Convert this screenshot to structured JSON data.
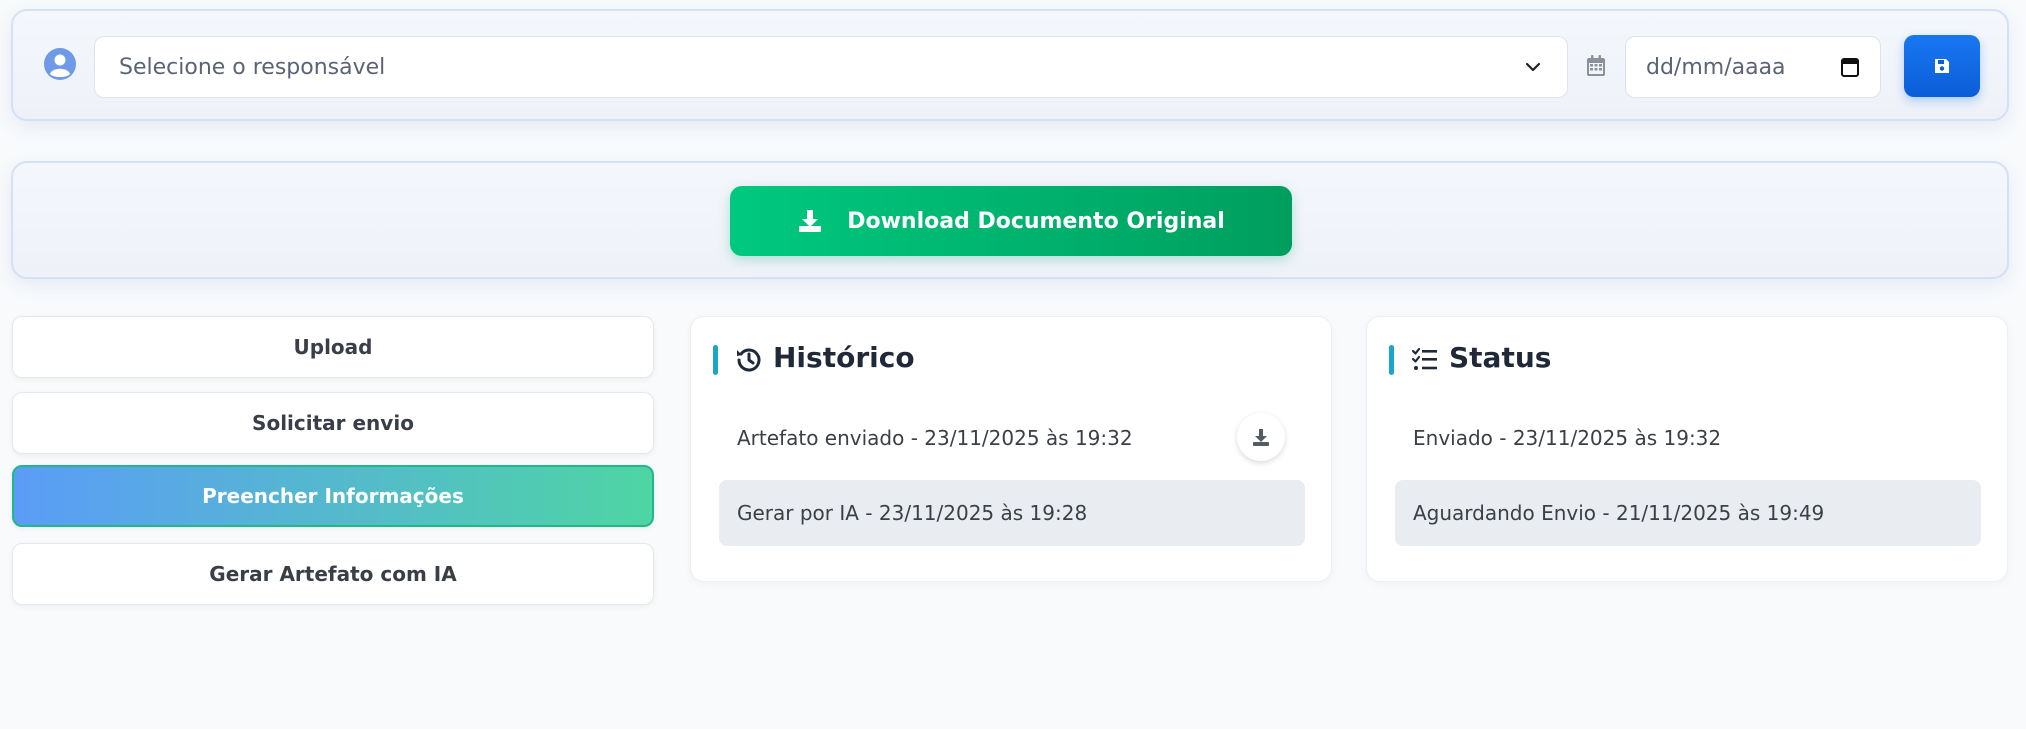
{
  "header": {
    "responsible_placeholder": "Selecione o responsável",
    "date_placeholder": "dd/mm/aaaa"
  },
  "download": {
    "label": "Download Documento Original"
  },
  "sidebar": {
    "buttons": [
      {
        "label": "Upload",
        "active": false
      },
      {
        "label": "Solicitar envio",
        "active": false
      },
      {
        "label": "Preencher Informações",
        "active": true
      },
      {
        "label": "Gerar Artefato com IA",
        "active": false
      }
    ]
  },
  "history": {
    "title": "Histórico",
    "items": [
      {
        "text": "Artefato enviado - 23/11/2025 às 19:32"
      },
      {
        "text": "Gerar por IA - 23/11/2025 às 19:28"
      }
    ]
  },
  "status": {
    "title": "Status",
    "items": [
      {
        "text": "Enviado - 23/11/2025 às 19:32"
      },
      {
        "text": "Aguardando Envio - 21/11/2025 às 19:49"
      }
    ]
  },
  "colors": {
    "primary": "#0d6efd",
    "success": "#00b36b",
    "accent": "#19a6c9"
  }
}
